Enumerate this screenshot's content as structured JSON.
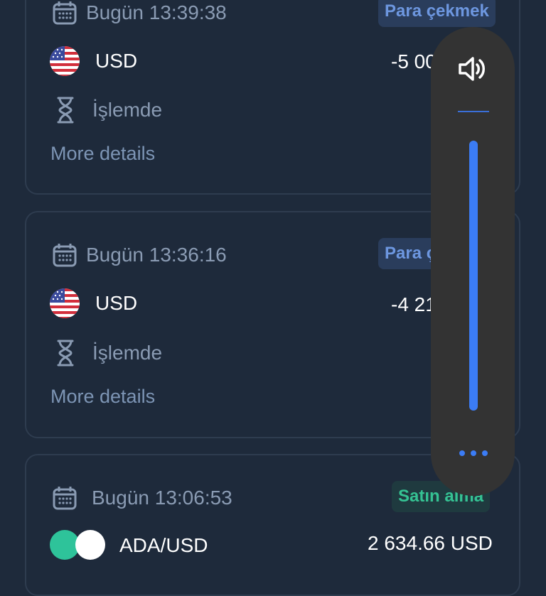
{
  "transactions": [
    {
      "date": "Bugün 13:39:38",
      "type_label": "Para çekmek",
      "currency": "USD",
      "amount": "-5 00",
      "status": "İşlemde",
      "details": "More details"
    },
    {
      "date": "Bugün 13:36:16",
      "type_label": "Para ç",
      "currency": "USD",
      "amount": "-4 21",
      "status": "İşlemde",
      "details": "More details"
    },
    {
      "date": "Bugün 13:06:53",
      "type_label": "Satın alma",
      "currency": "ADA/USD",
      "amount": "2 634.66 USD"
    }
  ],
  "volume": {
    "icon": "speaker-icon",
    "level_percent": 100,
    "more_icon": "more-dots-icon"
  },
  "colors": {
    "background": "#1e2a3b",
    "withdraw_badge": "#6d97e0",
    "buy_badge": "#35c293",
    "volume_accent": "#3b7cf5"
  }
}
